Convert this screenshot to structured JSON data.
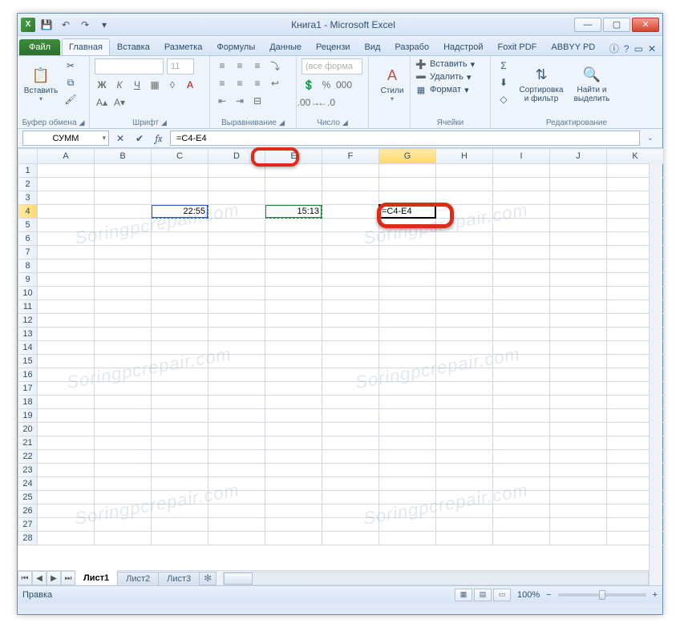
{
  "window": {
    "title": "Книга1  -  Microsoft Excel"
  },
  "qat": {
    "excel_letter": "X"
  },
  "tabs": {
    "file": "Файл",
    "items": [
      "Главная",
      "Вставка",
      "Разметка",
      "Формулы",
      "Данные",
      "Рецензи",
      "Вид",
      "Разрабо",
      "Надстрой",
      "Foxit PDF",
      "ABBYY PD"
    ],
    "active_index": 0
  },
  "ribbon": {
    "clipboard": {
      "paste": "Вставить",
      "label": "Буфер обмена"
    },
    "font": {
      "name": "",
      "size": "11",
      "label": "Шрифт"
    },
    "alignment": {
      "label": "Выравнивание"
    },
    "number": {
      "format": "(все форма",
      "label": "Число"
    },
    "styles": {
      "btn": "Стили",
      "label": ""
    },
    "cells": {
      "insert": "Вставить",
      "delete": "Удалить",
      "format": "Формат",
      "label": "Ячейки"
    },
    "editing": {
      "sort": "Сортировка\nи фильтр",
      "find": "Найти и\nвыделить",
      "label": "Редактирование"
    }
  },
  "formula_bar": {
    "name_box": "СУММ",
    "formula": "=C4-E4"
  },
  "grid": {
    "columns": [
      "A",
      "B",
      "C",
      "D",
      "E",
      "F",
      "G",
      "H",
      "I",
      "J",
      "K"
    ],
    "rows": 28,
    "active_col": "G",
    "active_row": 4,
    "cells": {
      "C4": "22:55",
      "E4": "15:13",
      "G4": "=C4-E4"
    },
    "ref_cells": {
      "C4": "blue",
      "E4": "green"
    }
  },
  "sheets": {
    "items": [
      "Лист1",
      "Лист2",
      "Лист3"
    ],
    "active_index": 0
  },
  "statusbar": {
    "mode": "Правка",
    "zoom": "100%",
    "zoom_minus": "−",
    "zoom_plus": "+"
  },
  "watermark": "Soringpcrepair.com"
}
